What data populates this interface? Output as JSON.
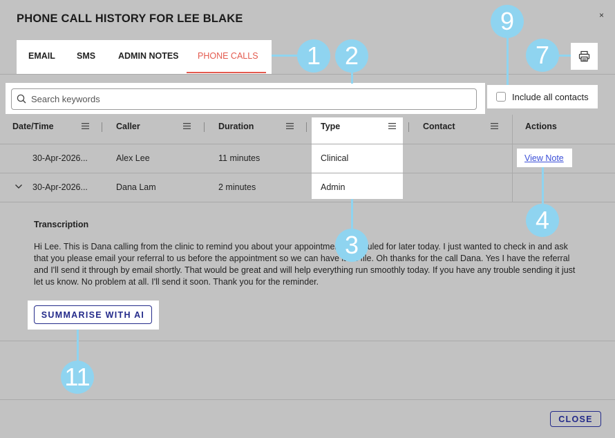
{
  "dialog": {
    "title": "PHONE CALL HISTORY FOR LEE BLAKE",
    "close_icon": "×"
  },
  "tabs": [
    {
      "label": "EMAIL",
      "active": false
    },
    {
      "label": "SMS",
      "active": false
    },
    {
      "label": "ADMIN NOTES",
      "active": false
    },
    {
      "label": "PHONE CALLS",
      "active": true
    }
  ],
  "search": {
    "placeholder": "Search keywords",
    "value": "",
    "icon": "search-icon"
  },
  "include_all_contacts": {
    "label": "Include all contacts",
    "checked": false
  },
  "print": {
    "icon": "printer-icon"
  },
  "table": {
    "columns": [
      "Date/Time",
      "Caller",
      "Duration",
      "Type",
      "Contact",
      "Actions"
    ],
    "rows": [
      {
        "datetime": "30-Apr-2026...",
        "caller": "Alex Lee",
        "duration": "11 minutes",
        "type": "Clinical",
        "contact": "",
        "action": "View Note",
        "expanded": false
      },
      {
        "datetime": "30-Apr-2026...",
        "caller": "Dana Lam",
        "duration": "2 minutes",
        "type": "Admin",
        "contact": "",
        "action": "",
        "expanded": true
      }
    ]
  },
  "transcription": {
    "title": "Transcription",
    "text": "Hi Lee. This is Dana calling from the clinic to remind you about your appointment scheduled for later today. I just wanted to check in and ask that you please email your referral to us before the appointment so we can have it on file. Oh thanks for the call Dana. Yes I have the referral and I'll send it through by email shortly. That would be great and will help everything run smoothly today. If you have any trouble sending it just let us know. No problem at all. I'll send it soon. Thank you for the reminder."
  },
  "summarise_button": "SUMMARISE WITH AI",
  "close_button": "CLOSE",
  "callouts": [
    "1",
    "2",
    "3",
    "4",
    "7",
    "9",
    "11"
  ],
  "colors": {
    "accent_tab": "#e35a4e",
    "button_navy": "#232a8a",
    "link_blue": "#3b4fd8",
    "callout": "#8fd4f0",
    "overlay_bg": "#c2c2c2"
  }
}
